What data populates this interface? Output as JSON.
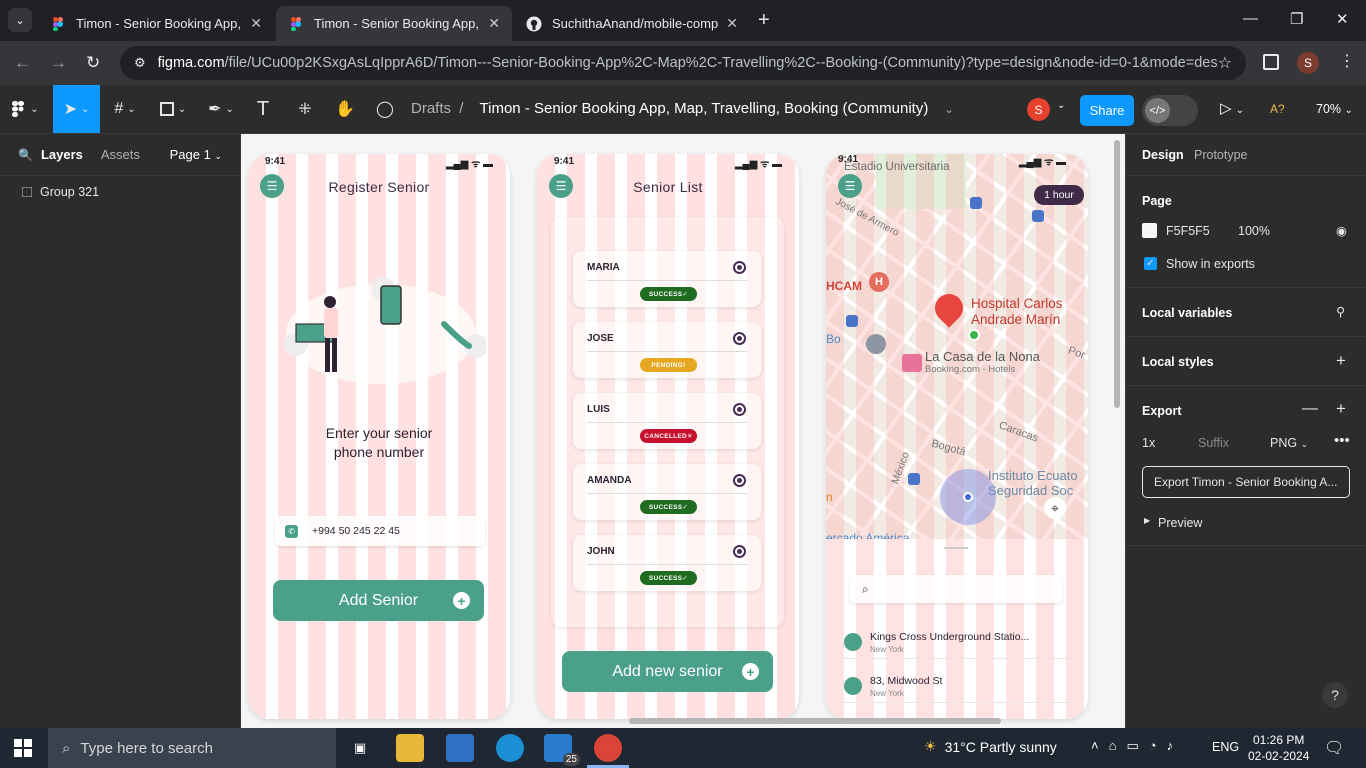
{
  "browser": {
    "tabs": [
      {
        "title": "Timon - Senior Booking App, M",
        "active": false
      },
      {
        "title": "Timon - Senior Booking App, M",
        "active": true
      },
      {
        "title": "SuchithaAnand/mobile-comput",
        "active": false
      }
    ],
    "url_domain": "figma.com",
    "url_path": "/file/UCu00p2KSxgAsLqIpprA6D/Timon---Senior-Booking-App%2C-Map%2C-Travelling%2C--Booking-(Community)?type=design&node-id=0-1&mode=desi...",
    "profile_initial": "S"
  },
  "figma": {
    "breadcrumb_root": "Drafts",
    "file_name": "Timon - Senior Booking App, Map, Travelling, Booking (Community)",
    "user_initial": "S",
    "share_label": "Share",
    "zoom": "70%",
    "font_badge": "A?",
    "left_tabs": {
      "layers": "Layers",
      "assets": "Assets",
      "page": "Page 1"
    },
    "layers": [
      "Group 321"
    ]
  },
  "register": {
    "time": "9:41",
    "title": "Register Senior",
    "prompt_line1": "Enter your senior",
    "prompt_line2": "phone number",
    "phone": "+994 50 245 22 45",
    "button": "Add Senior"
  },
  "list": {
    "time": "9:41",
    "title": "Senior List",
    "seniors": [
      {
        "name": "MARIA",
        "status": "SUCCESS"
      },
      {
        "name": "JOSE",
        "status": "PENDING"
      },
      {
        "name": "LUIS",
        "status": "CANCELLED"
      },
      {
        "name": "AMANDA",
        "status": "SUCCESS"
      },
      {
        "name": "JOHN",
        "status": "SUCCESS"
      }
    ],
    "button": "Add new senior",
    "status_colors": {
      "SUCCESS": "#1f6b1f",
      "PENDING": "#e6a820",
      "CANCELLED": "#c8102e"
    }
  },
  "map": {
    "time": "9:41",
    "duration": "1 hour",
    "labels": {
      "stadium": "Estadio Universitaria",
      "street1": "José de Armero",
      "hcam": "HCAM",
      "hospital_1": "Hospital Carlos",
      "hospital_2": "Andrade Marín",
      "hotel": "La Casa de la Nona",
      "hotel_sub": "Booking.com - Hotels",
      "bogota": "Bogotá",
      "caracas": "Caracas",
      "mexico": "México",
      "instituto_1": "Instituto Ecuato",
      "instituto_2": "Seguridad Soc",
      "mercado": "ercado América",
      "bo": "Bo",
      "por": "Por",
      "n": "n"
    },
    "results": [
      {
        "title": "Kings Cross Underground Statio...",
        "sub": "New York"
      },
      {
        "title": "83, Midwood St",
        "sub": "New York"
      }
    ]
  },
  "design_panel": {
    "tabs": {
      "design": "Design",
      "prototype": "Prototype"
    },
    "page_heading": "Page",
    "page_color": "F5F5F5",
    "page_opacity": "100%",
    "show_in_exports": "Show in exports",
    "local_variables": "Local variables",
    "local_styles": "Local styles",
    "export_heading": "Export",
    "export_scale": "1x",
    "export_suffix": "Suffix",
    "export_format": "PNG",
    "export_button": "Export Timon - Senior Booking A...",
    "preview": "Preview"
  },
  "taskbar": {
    "search_placeholder": "Type here to search",
    "weather": "31°C  Partly sunny",
    "lang": "ENG",
    "time": "01:26 PM",
    "date": "02-02-2024",
    "mail_badge": "25"
  }
}
